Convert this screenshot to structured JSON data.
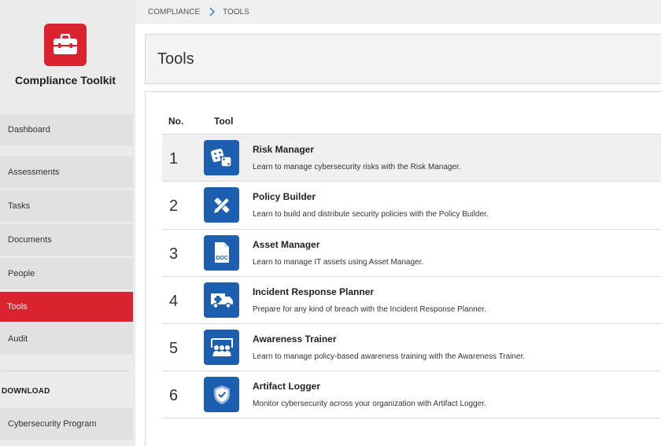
{
  "app": {
    "name": "Compliance Toolkit",
    "accent": "#d9232e",
    "icon_blue": "#1c5fb0",
    "logo_icon": "toolbox-icon"
  },
  "sidebar": {
    "items": [
      {
        "label": "Dashboard"
      },
      {
        "label": "Assessments"
      },
      {
        "label": "Tasks"
      },
      {
        "label": "Documents"
      },
      {
        "label": "People"
      },
      {
        "label": "Tools",
        "active": true
      },
      {
        "label": "Audit"
      }
    ],
    "download_heading": "DOWNLOAD",
    "download_items": [
      {
        "label": "Cybersecurity Program"
      }
    ]
  },
  "breadcrumb": {
    "items": [
      "COMPLIANCE",
      "TOOLS"
    ],
    "separator_icon": "chevron-right-icon"
  },
  "page": {
    "title": "Tools"
  },
  "table": {
    "headers": {
      "no": "No.",
      "tool": "Tool"
    },
    "rows": [
      {
        "no": "1",
        "icon": "dice-icon",
        "title": "Risk Manager",
        "desc": "Learn to manage cybersecurity risks with the Risk Manager."
      },
      {
        "no": "2",
        "icon": "pencil-ruler-icon",
        "title": "Policy Builder",
        "desc": "Learn to build and distribute security policies with the Policy Builder."
      },
      {
        "no": "3",
        "icon": "doc-file-icon",
        "title": "Asset Manager",
        "desc": "Learn to manage IT assets using Asset Manager.",
        "icon_text": "DOC"
      },
      {
        "no": "4",
        "icon": "ambulance-icon",
        "title": "Incident Response Planner",
        "desc": "Prepare for any kind of breach with the Incident Response Planner."
      },
      {
        "no": "5",
        "icon": "presentation-audience-icon",
        "title": "Awareness Trainer",
        "desc": "Learn to manage policy-based awareness training with the Awareness Trainer."
      },
      {
        "no": "6",
        "icon": "shield-check-icon",
        "title": "Artifact Logger",
        "desc": "Monitor cybersecurity across your organization with Artifact Logger."
      }
    ]
  }
}
